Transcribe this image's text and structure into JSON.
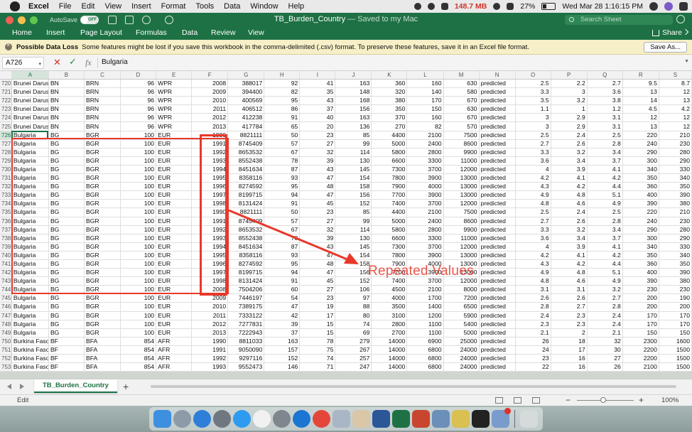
{
  "menubar": {
    "app": "Excel",
    "items": [
      "File",
      "Edit",
      "View",
      "Insert",
      "Format",
      "Tools",
      "Data",
      "Window",
      "Help"
    ],
    "memory": "148.7 MB",
    "battery": "27%",
    "datetime": "Wed Mar 28  1:16:15 PM"
  },
  "titlebar": {
    "autosave_label": "AutoSave",
    "autosave_state": "OFF",
    "doc_name": "TB_Burden_Country",
    "doc_status": " — Saved to my Mac",
    "search_placeholder": "Search Sheet"
  },
  "ribbon": {
    "tabs": [
      "Home",
      "Insert",
      "Page Layout",
      "Formulas",
      "Data",
      "Review",
      "View"
    ],
    "share_label": "Share"
  },
  "message_bar": {
    "title": "Possible Data Loss",
    "text": "Some features might be lost if you save this workbook in the comma-delimited (.csv) format. To preserve these features, save it in an Excel file format.",
    "button": "Save As..."
  },
  "formula_bar": {
    "name_box": "A726",
    "fx": "fx",
    "value": "Bulgaria"
  },
  "columns": [
    "A",
    "B",
    "C",
    "D",
    "E",
    "F",
    "G",
    "H",
    "I",
    "J",
    "K",
    "L",
    "M",
    "N",
    "O",
    "P",
    "Q",
    "R",
    "S"
  ],
  "rows": [
    {
      "n": "720",
      "c": [
        "Brunei Darus",
        "BN",
        "BRN",
        "96",
        "WPR",
        "2008",
        "388017",
        "92",
        "41",
        "163",
        "360",
        "160",
        "630",
        "predicted",
        "2.5",
        "2.2",
        "2.7",
        "9.5",
        "8.7"
      ]
    },
    {
      "n": "721",
      "c": [
        "Brunei Darus",
        "BN",
        "BRN",
        "96",
        "WPR",
        "2009",
        "394400",
        "82",
        "35",
        "148",
        "320",
        "140",
        "580",
        "predicted",
        "3.3",
        "3",
        "3.6",
        "13",
        "12"
      ]
    },
    {
      "n": "722",
      "c": [
        "Brunei Darus",
        "BN",
        "BRN",
        "96",
        "WPR",
        "2010",
        "400569",
        "95",
        "43",
        "168",
        "380",
        "170",
        "670",
        "predicted",
        "3.5",
        "3.2",
        "3.8",
        "14",
        "13"
      ]
    },
    {
      "n": "723",
      "c": [
        "Brunei Darus",
        "BN",
        "BRN",
        "96",
        "WPR",
        "2011",
        "406512",
        "86",
        "37",
        "156",
        "350",
        "150",
        "630",
        "predicted",
        "1.1",
        "1",
        "1.2",
        "4.5",
        "4.2"
      ]
    },
    {
      "n": "724",
      "c": [
        "Brunei Darus",
        "BN",
        "BRN",
        "96",
        "WPR",
        "2012",
        "412238",
        "91",
        "40",
        "163",
        "370",
        "160",
        "670",
        "predicted",
        "3",
        "2.9",
        "3.1",
        "12",
        "12"
      ]
    },
    {
      "n": "725",
      "c": [
        "Brunei Darus",
        "BN",
        "BRN",
        "96",
        "WPR",
        "2013",
        "417784",
        "65",
        "20",
        "136",
        "270",
        "82",
        "570",
        "predicted",
        "3",
        "2.9",
        "3.1",
        "13",
        "12"
      ]
    },
    {
      "n": "726",
      "c": [
        "Bulgaria",
        "BG",
        "BGR",
        "100",
        "EUR",
        "1990",
        "8821111",
        "50",
        "23",
        "85",
        "4400",
        "2100",
        "7500",
        "predicted",
        "2.5",
        "2.4",
        "2.5",
        "220",
        "210"
      ]
    },
    {
      "n": "727",
      "c": [
        "Bulgaria",
        "BG",
        "BGR",
        "100",
        "EUR",
        "1991",
        "8745409",
        "57",
        "27",
        "99",
        "5000",
        "2400",
        "8600",
        "predicted",
        "2.7",
        "2.6",
        "2.8",
        "240",
        "230"
      ]
    },
    {
      "n": "728",
      "c": [
        "Bulgaria",
        "BG",
        "BGR",
        "100",
        "EUR",
        "1992",
        "8653532",
        "67",
        "32",
        "114",
        "5800",
        "2800",
        "9900",
        "predicted",
        "3.3",
        "3.2",
        "3.4",
        "290",
        "280"
      ]
    },
    {
      "n": "729",
      "c": [
        "Bulgaria",
        "BG",
        "BGR",
        "100",
        "EUR",
        "1993",
        "8552438",
        "78",
        "39",
        "130",
        "6600",
        "3300",
        "11000",
        "predicted",
        "3.6",
        "3.4",
        "3.7",
        "300",
        "290"
      ]
    },
    {
      "n": "730",
      "c": [
        "Bulgaria",
        "BG",
        "BGR",
        "100",
        "EUR",
        "1994",
        "8451634",
        "87",
        "43",
        "145",
        "7300",
        "3700",
        "12000",
        "predicted",
        "4",
        "3.9",
        "4.1",
        "340",
        "330"
      ]
    },
    {
      "n": "731",
      "c": [
        "Bulgaria",
        "BG",
        "BGR",
        "100",
        "EUR",
        "1995",
        "8358116",
        "93",
        "47",
        "154",
        "7800",
        "3900",
        "13000",
        "predicted",
        "4.2",
        "4.1",
        "4.2",
        "350",
        "340"
      ]
    },
    {
      "n": "732",
      "c": [
        "Bulgaria",
        "BG",
        "BGR",
        "100",
        "EUR",
        "1996",
        "8274592",
        "95",
        "48",
        "158",
        "7900",
        "4000",
        "13000",
        "predicted",
        "4.3",
        "4.2",
        "4.4",
        "360",
        "350"
      ]
    },
    {
      "n": "733",
      "c": [
        "Bulgaria",
        "BG",
        "BGR",
        "100",
        "EUR",
        "1997",
        "8199715",
        "94",
        "47",
        "156",
        "7700",
        "3900",
        "13000",
        "predicted",
        "4.9",
        "4.8",
        "5.1",
        "400",
        "390"
      ]
    },
    {
      "n": "734",
      "c": [
        "Bulgaria",
        "BG",
        "BGR",
        "100",
        "EUR",
        "1998",
        "8131424",
        "91",
        "45",
        "152",
        "7400",
        "3700",
        "12000",
        "predicted",
        "4.8",
        "4.6",
        "4.9",
        "390",
        "380"
      ]
    },
    {
      "n": "735",
      "c": [
        "Bulgaria",
        "BG",
        "BGR",
        "100",
        "EUR",
        "1990",
        "8821111",
        "50",
        "23",
        "85",
        "4400",
        "2100",
        "7500",
        "predicted",
        "2.5",
        "2.4",
        "2.5",
        "220",
        "210"
      ]
    },
    {
      "n": "736",
      "c": [
        "Bulgaria",
        "BG",
        "BGR",
        "100",
        "EUR",
        "1991",
        "8745409",
        "57",
        "27",
        "99",
        "5000",
        "2400",
        "8600",
        "predicted",
        "2.7",
        "2.6",
        "2.8",
        "240",
        "230"
      ]
    },
    {
      "n": "737",
      "c": [
        "Bulgaria",
        "BG",
        "BGR",
        "100",
        "EUR",
        "1992",
        "8653532",
        "67",
        "32",
        "114",
        "5800",
        "2800",
        "9900",
        "predicted",
        "3.3",
        "3.2",
        "3.4",
        "290",
        "280"
      ]
    },
    {
      "n": "738",
      "c": [
        "Bulgaria",
        "BG",
        "BGR",
        "100",
        "EUR",
        "1993",
        "8552438",
        "78",
        "39",
        "130",
        "6600",
        "3300",
        "11000",
        "predicted",
        "3.6",
        "3.4",
        "3.7",
        "300",
        "290"
      ]
    },
    {
      "n": "739",
      "c": [
        "Bulgaria",
        "BG",
        "BGR",
        "100",
        "EUR",
        "1994",
        "8451634",
        "87",
        "43",
        "145",
        "7300",
        "3700",
        "12000",
        "predicted",
        "4",
        "3.9",
        "4.1",
        "340",
        "330"
      ]
    },
    {
      "n": "740",
      "c": [
        "Bulgaria",
        "BG",
        "BGR",
        "100",
        "EUR",
        "1995",
        "8358116",
        "93",
        "47",
        "154",
        "7800",
        "3900",
        "13000",
        "predicted",
        "4.2",
        "4.1",
        "4.2",
        "350",
        "340"
      ]
    },
    {
      "n": "741",
      "c": [
        "Bulgaria",
        "BG",
        "BGR",
        "100",
        "EUR",
        "1996",
        "8274592",
        "95",
        "48",
        "158",
        "7900",
        "4000",
        "13000",
        "predicted",
        "4.3",
        "4.2",
        "4.4",
        "360",
        "350"
      ]
    },
    {
      "n": "742",
      "c": [
        "Bulgaria",
        "BG",
        "BGR",
        "100",
        "EUR",
        "1997",
        "8199715",
        "94",
        "47",
        "156",
        "7700",
        "3900",
        "13000",
        "predicted",
        "4.9",
        "4.8",
        "5.1",
        "400",
        "390"
      ]
    },
    {
      "n": "743",
      "c": [
        "Bulgaria",
        "BG",
        "BGR",
        "100",
        "EUR",
        "1998",
        "8131424",
        "91",
        "45",
        "152",
        "7400",
        "3700",
        "12000",
        "predicted",
        "4.8",
        "4.6",
        "4.9",
        "390",
        "380"
      ]
    },
    {
      "n": "744",
      "c": [
        "Bulgaria",
        "BG",
        "BGR",
        "100",
        "EUR",
        "2008",
        "7504206",
        "60",
        "27",
        "106",
        "4500",
        "2100",
        "8000",
        "predicted",
        "3.1",
        "3.1",
        "3.2",
        "230",
        "230"
      ]
    },
    {
      "n": "745",
      "c": [
        "Bulgaria",
        "BG",
        "BGR",
        "100",
        "EUR",
        "2009",
        "7446197",
        "54",
        "23",
        "97",
        "4000",
        "1700",
        "7200",
        "predicted",
        "2.6",
        "2.6",
        "2.7",
        "200",
        "190"
      ]
    },
    {
      "n": "746",
      "c": [
        "Bulgaria",
        "BG",
        "BGR",
        "100",
        "EUR",
        "2010",
        "7389175",
        "47",
        "19",
        "88",
        "3500",
        "1400",
        "6500",
        "predicted",
        "2.8",
        "2.7",
        "2.8",
        "200",
        "200"
      ]
    },
    {
      "n": "747",
      "c": [
        "Bulgaria",
        "BG",
        "BGR",
        "100",
        "EUR",
        "2011",
        "7333122",
        "42",
        "17",
        "80",
        "3100",
        "1200",
        "5900",
        "predicted",
        "2.4",
        "2.3",
        "2.4",
        "170",
        "170"
      ]
    },
    {
      "n": "748",
      "c": [
        "Bulgaria",
        "BG",
        "BGR",
        "100",
        "EUR",
        "2012",
        "7277831",
        "39",
        "15",
        "74",
        "2800",
        "1100",
        "5400",
        "predicted",
        "2.3",
        "2.3",
        "2.4",
        "170",
        "170"
      ]
    },
    {
      "n": "749",
      "c": [
        "Bulgaria",
        "BG",
        "BGR",
        "100",
        "EUR",
        "2013",
        "7222943",
        "37",
        "15",
        "69",
        "2700",
        "1100",
        "5000",
        "predicted",
        "2.1",
        "2",
        "2.1",
        "150",
        "150"
      ]
    },
    {
      "n": "750",
      "c": [
        "Burkina Faso",
        "BF",
        "BFA",
        "854",
        "AFR",
        "1990",
        "8811033",
        "163",
        "78",
        "279",
        "14000",
        "6900",
        "25000",
        "predicted",
        "26",
        "18",
        "32",
        "2300",
        "1600"
      ]
    },
    {
      "n": "751",
      "c": [
        "Burkina Faso",
        "BF",
        "BFA",
        "854",
        "AFR",
        "1991",
        "9050090",
        "157",
        "75",
        "267",
        "14000",
        "6800",
        "24000",
        "predicted",
        "24",
        "17",
        "30",
        "2200",
        "1500"
      ]
    },
    {
      "n": "752",
      "c": [
        "Burkina Faso",
        "BF",
        "BFA",
        "854",
        "AFR",
        "1992",
        "9297116",
        "152",
        "74",
        "257",
        "14000",
        "6800",
        "24000",
        "predicted",
        "23",
        "16",
        "27",
        "2200",
        "1500"
      ]
    },
    {
      "n": "753",
      "c": [
        "Burkina Faso",
        "BF",
        "BFA",
        "854",
        "AFR",
        "1993",
        "9552473",
        "146",
        "71",
        "247",
        "14000",
        "6800",
        "24000",
        "predicted",
        "22",
        "16",
        "26",
        "2100",
        "1500"
      ]
    }
  ],
  "annotation": {
    "text": "Repeated Values",
    "color": "#e8382a"
  },
  "sheet_tabs": [
    "TB_Burden_Country"
  ],
  "status": {
    "mode": "Edit",
    "zoom": "100%"
  },
  "colors": {
    "excel_green": "#1e7145",
    "message_bar": "#f6efc7"
  },
  "dock": {
    "icons": [
      "finder-icon",
      "launchpad-icon",
      "safari-icon",
      "system-icon",
      "app-store-icon",
      "itunes-icon",
      "system-preferences-icon",
      "teamviewer-icon",
      "chrome-icon",
      "photos-icon",
      "preview-icon",
      "word-icon",
      "excel-icon",
      "powerpoint-icon",
      "network-icon",
      "python-icon",
      "terminal-icon",
      "mail-icon",
      "trash-icon"
    ]
  }
}
